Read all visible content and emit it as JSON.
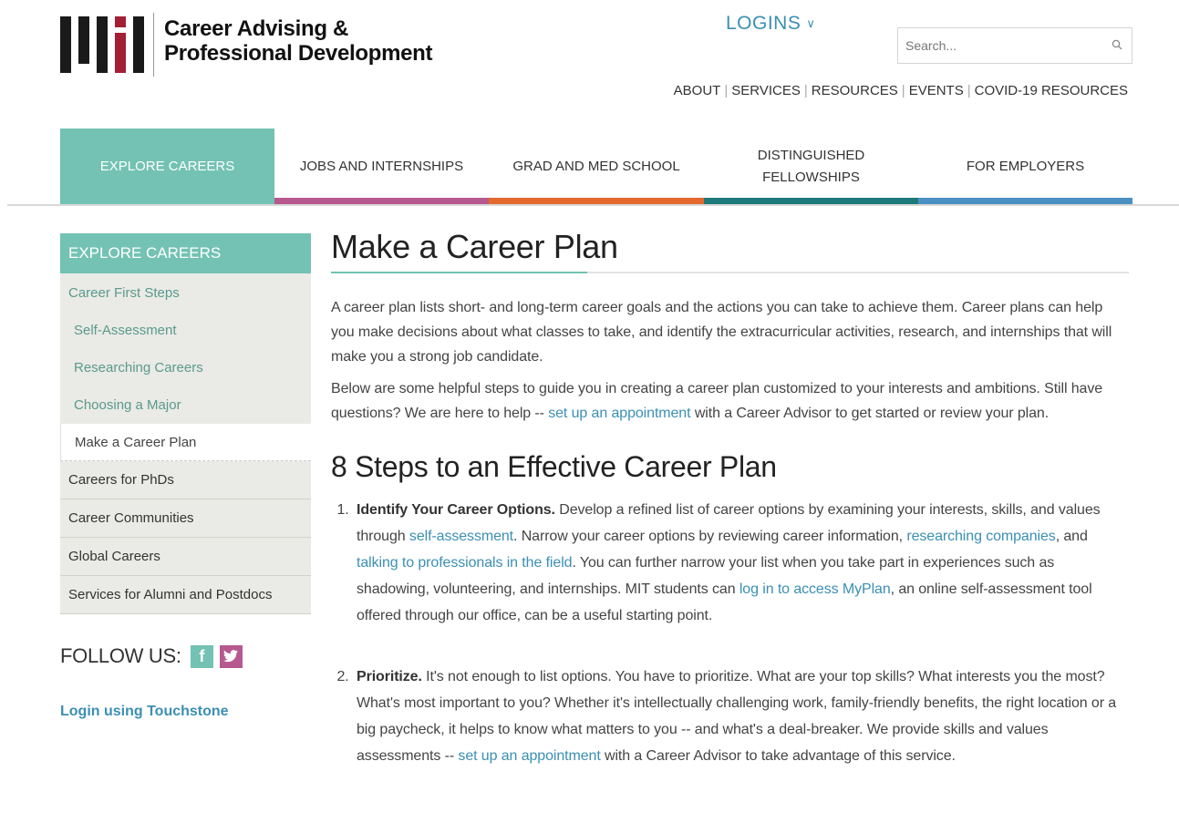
{
  "header": {
    "logo_line1": "Career Advising &",
    "logo_line2": "Professional Development",
    "logins_label": "LOGINS",
    "search_placeholder": "Search...",
    "utility_links": [
      "ABOUT",
      "SERVICES",
      "RESOURCES",
      "EVENTS",
      "COVID-19 RESOURCES"
    ]
  },
  "mainnav": {
    "items": [
      {
        "label": "EXPLORE CAREERS",
        "color": "#73c2b3"
      },
      {
        "label": "JOBS AND INTERNSHIPS",
        "color": "#b7588f"
      },
      {
        "label": "GRAD AND MED SCHOOL",
        "color": "#e3692e"
      },
      {
        "label": "DISTINGUISHED",
        "label2": "FELLOWSHIPS",
        "color": "#1d7a7a"
      },
      {
        "label": "FOR EMPLOYERS",
        "color": "#4a90c2"
      }
    ]
  },
  "sidebar": {
    "heading": "EXPLORE CAREERS",
    "items": [
      "Career First Steps",
      "Self-Assessment",
      "Researching Careers",
      "Choosing a Major",
      "Make a Career Plan",
      "Careers for PhDs",
      "Career Communities",
      "Global Careers",
      "Services for Alumni and Postdocs"
    ],
    "follow_label": "FOLLOW US:",
    "login_link": "Login using Touchstone"
  },
  "content": {
    "title": "Make a Career Plan",
    "para1": "A career plan lists short- and long-term career goals and the actions you can take to achieve them. Career plans can help you make decisions about what classes to take, and identify the extracurricular activities, research, and internships that will make you a strong job candidate.",
    "para2_before": "Below are some helpful steps to guide you in creating a career plan customized to your interests and ambitions. Still have questions? We are here to help -- ",
    "para2_link": "set up an appointment",
    "para2_after": " with a Career Advisor to get started or review your plan.",
    "section_title": "8 Steps to an Effective Career Plan",
    "steps": [
      {
        "heading": "Identify Your Career Options.",
        "t1": " Develop a refined list of career options by examining your interests, skills, and values through ",
        "l1": "self-assessment",
        "t2": ". Narrow your career options by reviewing career information, ",
        "l2": "researching companies",
        "t3": ", and ",
        "l3": "talking to professionals in the field",
        "t4": ". You can further narrow your list when you take part in experiences such as shadowing, volunteering, and internships. MIT students can ",
        "l4": "log in to access MyPlan",
        "t5": ", an online self-assessment tool offered through our office, can be a useful starting point."
      },
      {
        "heading": "Prioritize.",
        "t1": " It's not enough to list options. You have to prioritize. What are your top skills? What interests you the most? What's most important to you? Whether it's intellectually challenging work, family-friendly benefits, the right location or a big paycheck, it helps to know what matters to you -- and what's a deal-breaker. We provide skills and values assessments -- ",
        "l1": "set up an appointment",
        "t2": " with a Career Advisor to take advantage of this service."
      }
    ]
  }
}
